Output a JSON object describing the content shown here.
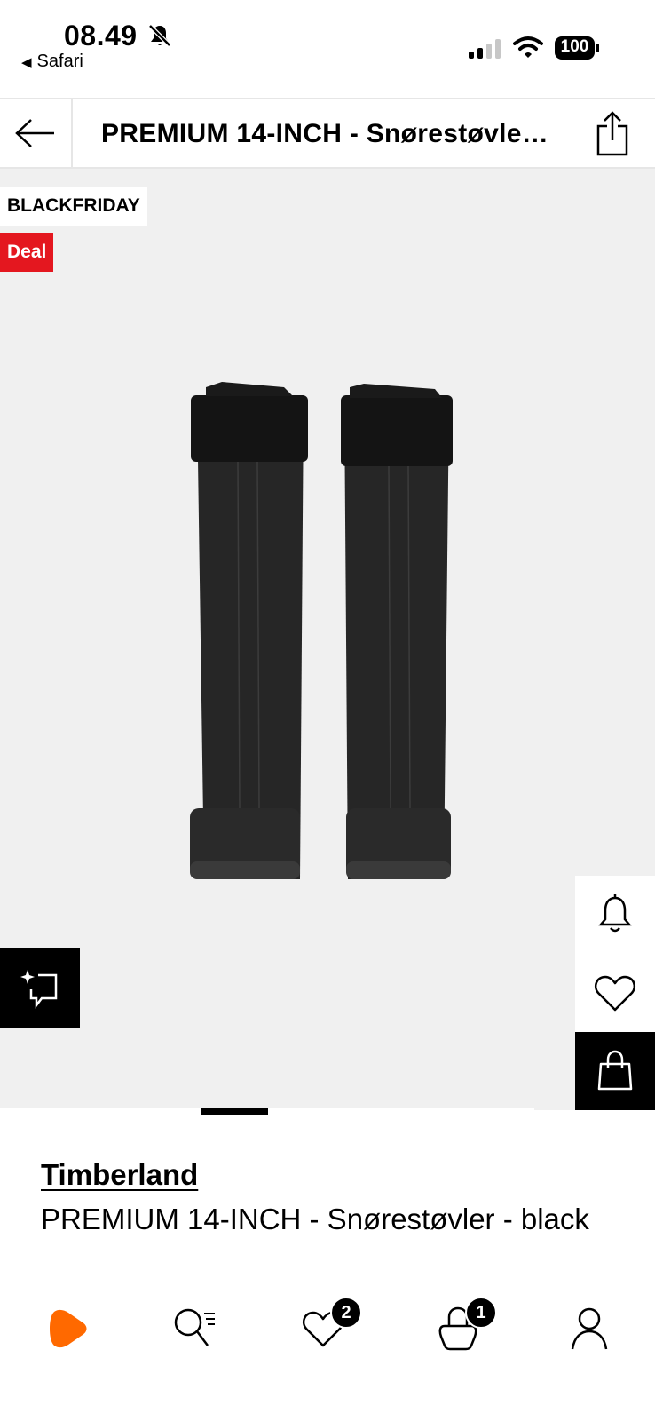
{
  "status_bar": {
    "time": "08.49",
    "back_app": "Safari",
    "battery": "100"
  },
  "header": {
    "title": "PREMIUM 14-INCH  - Snørestøvler - black"
  },
  "gallery": {
    "badge_blackfriday": "BLACKFRIDAY",
    "badge_deal": "Deal",
    "deal_color": "#e4171f",
    "current_image": 2,
    "image_count": 8
  },
  "product": {
    "brand": "Timberland",
    "name": "PREMIUM 14-INCH  - Snørestøvler - black"
  },
  "bottom_nav": {
    "wishlist_count": "2",
    "bag_count": "1",
    "brand_color": "#ff6900"
  }
}
